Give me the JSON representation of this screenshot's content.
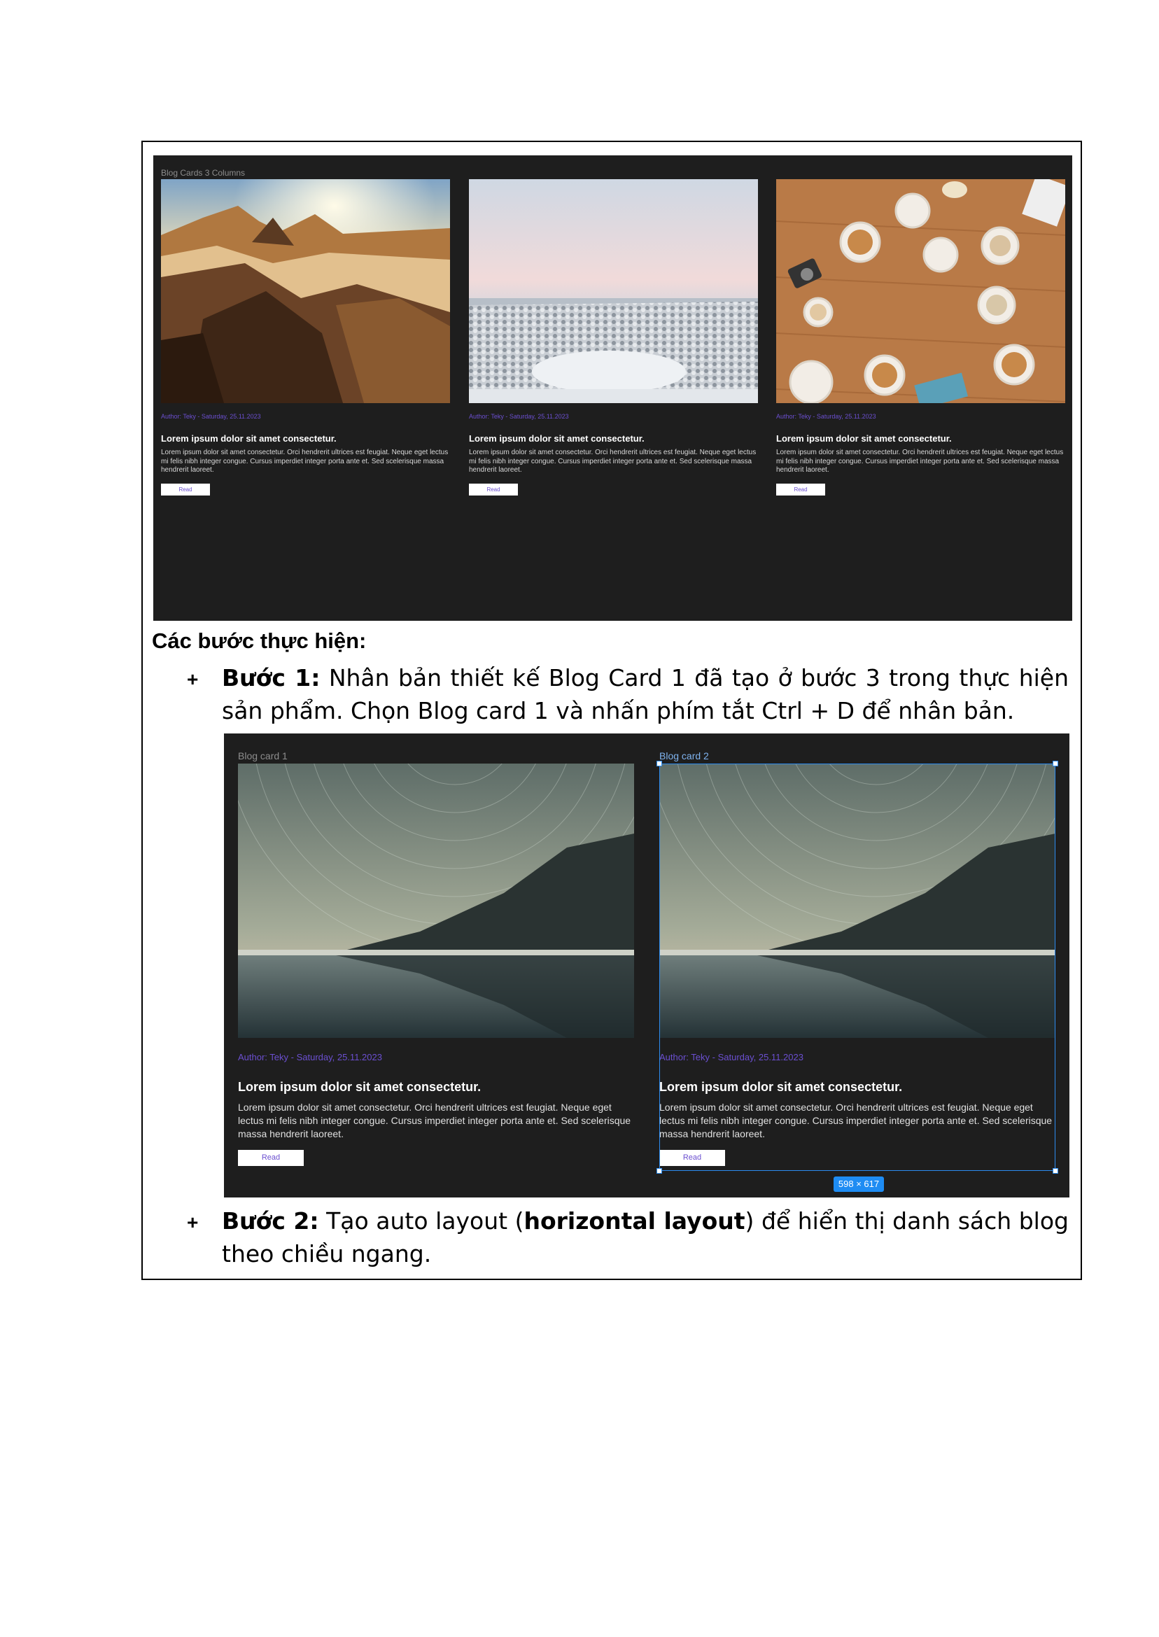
{
  "screenshot_top": {
    "frame_label": "Blog Cards 3 Columns",
    "cards": [
      {
        "image": "desert-mountains-sunset",
        "author": "Author: Teky - Saturday, 25.11.2023",
        "title": "Lorem ipsum dolor sit amet consectetur.",
        "description": "Lorem ipsum dolor sit amet consectetur. Orci hendrerit ultrices est feugiat. Neque eget lectus mi felis nibh integer congue. Cursus imperdiet integer porta ante et. Sed scelerisque massa hendrerit laoreet.",
        "button": "Read"
      },
      {
        "image": "snowy-forest",
        "author": "Author: Teky - Saturday, 25.11.2023",
        "title": "Lorem ipsum dolor sit amet consectetur.",
        "description": "Lorem ipsum dolor sit amet consectetur. Orci hendrerit ultrices est feugiat. Neque eget lectus mi felis nibh integer congue. Cursus imperdiet integer porta ante et. Sed scelerisque massa hendrerit laoreet.",
        "button": "Read"
      },
      {
        "image": "coffee-cups-on-table",
        "author": "Author: Teky - Saturday, 25.11.2023",
        "title": "Lorem ipsum dolor sit amet consectetur.",
        "description": "Lorem ipsum dolor sit amet consectetur. Orci hendrerit ultrices est feugiat. Neque eget lectus mi felis nibh integer congue. Cursus imperdiet integer porta ante et. Sed scelerisque massa hendrerit laoreet.",
        "button": "Read"
      }
    ]
  },
  "heading": "Các bước thực hiện:",
  "steps": [
    {
      "bullet": "+",
      "label": "Bước 1:",
      "text": " Nhân bản thiết kế Blog Card 1 đã tạo ở bước 3 trong thực hiện sản phẩm. Chọn Blog card 1 và nhấn phím tắt Ctrl + D để nhân bản."
    },
    {
      "bullet": "+",
      "label": "Bước 2:",
      "text_before": " Tạo auto layout (",
      "bold": "horizontal layout",
      "text_after": ") để hiển thị danh sách blog theo chiều ngang."
    }
  ],
  "screenshot_bottom": {
    "cards": [
      {
        "frame_label": "Blog card 1",
        "image": "star-trails-mountain-lake",
        "author": "Author: Teky - Saturday, 25.11.2023",
        "title": "Lorem ipsum dolor sit amet consectetur.",
        "description": "Lorem ipsum dolor sit amet consectetur. Orci hendrerit ultrices est feugiat. Neque eget lectus mi felis nibh integer congue. Cursus imperdiet integer porta ante et. Sed scelerisque massa hendrerit laoreet.",
        "button": "Read"
      },
      {
        "frame_label": "Blog card 2",
        "image": "star-trails-mountain-lake",
        "author": "Author: Teky - Saturday, 25.11.2023",
        "title": "Lorem ipsum dolor sit amet consectetur.",
        "description": "Lorem ipsum dolor sit amet consectetur. Orci hendrerit ultrices est feugiat. Neque eget lectus mi felis nibh integer congue. Cursus imperdiet integer porta ante et. Sed scelerisque massa hendrerit laoreet.",
        "button": "Read"
      }
    ],
    "selection_size": "598 × 617"
  },
  "colors": {
    "canvas": "#1e1e1e",
    "author_text": "#6b4fd0",
    "selection": "#2d8cf0"
  }
}
